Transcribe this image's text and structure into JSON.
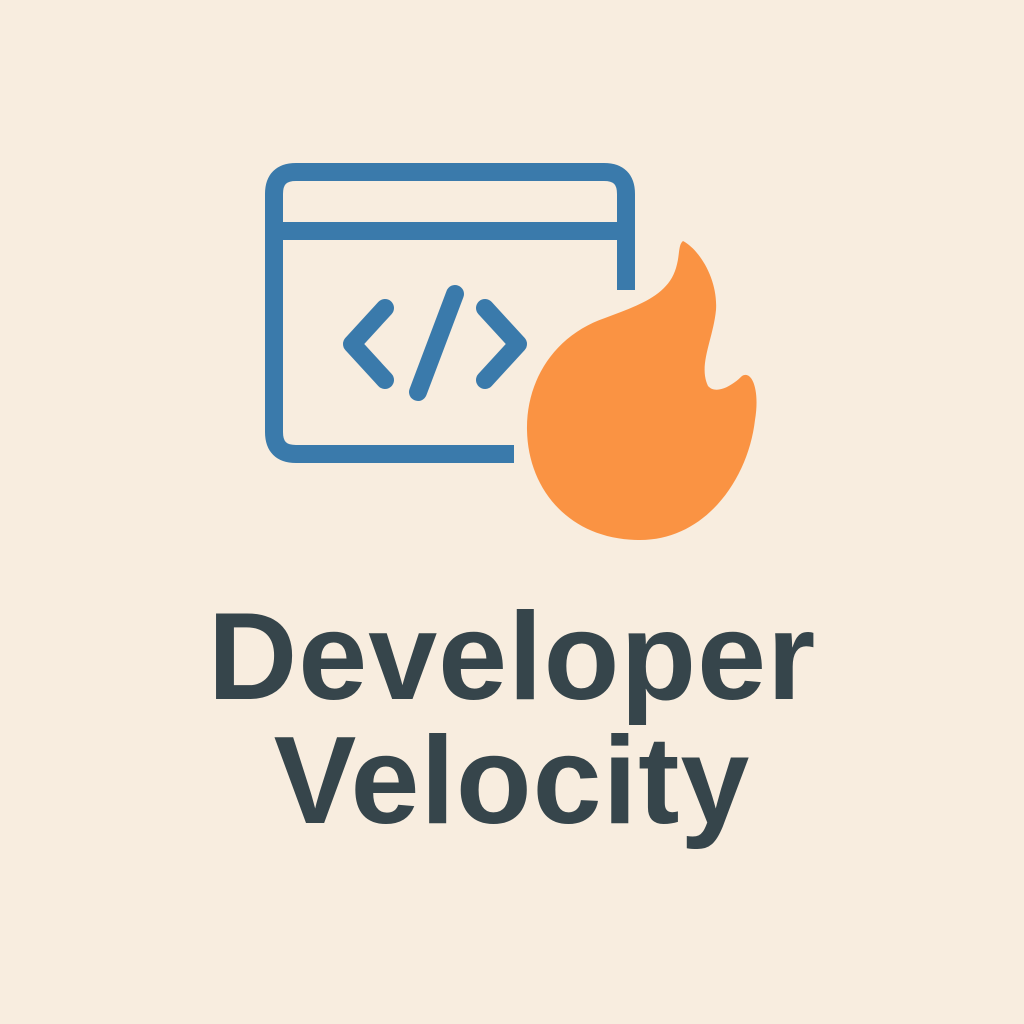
{
  "brand": {
    "title_line1": "Developer",
    "title_line2": "Velocity"
  },
  "colors": {
    "background": "#f8eddf",
    "window_stroke": "#3a7aab",
    "flame": "#fa9343",
    "text": "#36454b"
  },
  "icons": {
    "window": "browser-window-icon",
    "code": "code-brackets-icon",
    "flame": "flame-icon"
  }
}
